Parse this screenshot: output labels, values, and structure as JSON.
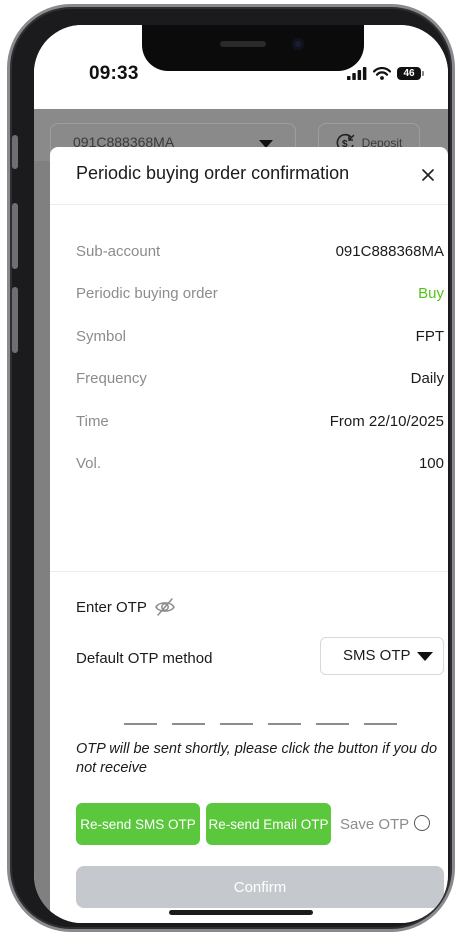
{
  "status_bar": {
    "time": "09:33",
    "battery": "46"
  },
  "background": {
    "account": "091C888368MA",
    "deposit_label": "Deposit"
  },
  "modal": {
    "title": "Periodic buying order confirmation",
    "rows": [
      {
        "label": "Sub-account",
        "value": "091C888368MA"
      },
      {
        "label": "Periodic buying order",
        "value": "Buy"
      },
      {
        "label": "Symbol",
        "value": "FPT"
      },
      {
        "label": "Frequency",
        "value": "Daily"
      },
      {
        "label": "Time",
        "value": "From 22/10/2025"
      },
      {
        "label": "Vol.",
        "value": "100"
      }
    ]
  },
  "otp": {
    "title": "Enter OTP",
    "method_label": "Default OTP method",
    "method_value": "SMS OTP",
    "digit_count": 6,
    "hint": "OTP will be sent shortly, please click the button if you do not receive",
    "resend_sms_label": "Re-send SMS OTP",
    "resend_email_label": "Re-send Email OTP",
    "save_otp_label": "Save OTP"
  },
  "confirm_label": "Confirm",
  "colors": {
    "accent_green": "#5ac73c",
    "buy_text": "#52c41a",
    "confirm_disabled": "#c5c9ce",
    "overlay": "#808080"
  }
}
